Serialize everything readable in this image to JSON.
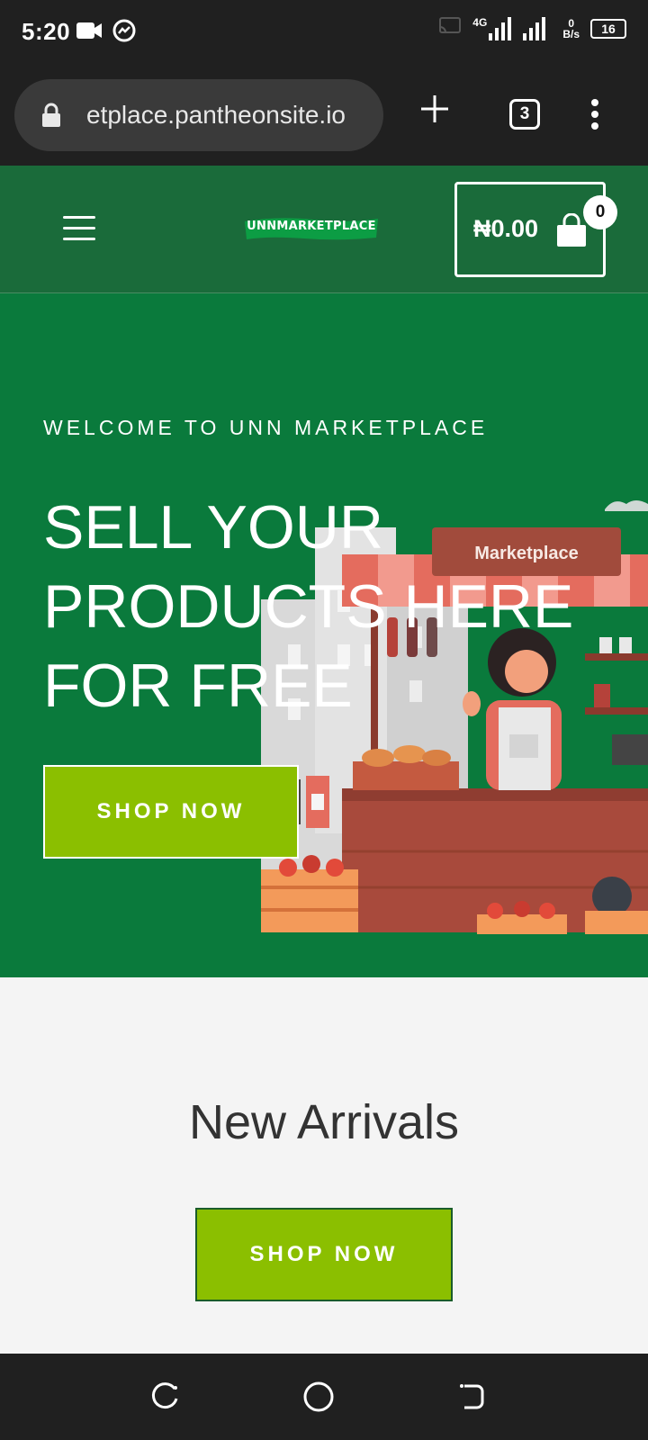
{
  "status_bar": {
    "time": "5:20",
    "network": "4G",
    "data_rate_value": "0",
    "data_rate_unit": "B/s",
    "battery": "16"
  },
  "browser": {
    "url": "etplace.pantheonsite.io",
    "tab_count": "3"
  },
  "header": {
    "logo_text": "UNNMARKETPLACE",
    "cart_total": "₦0.00",
    "cart_count": "0"
  },
  "hero": {
    "kicker": "WELCOME TO UNN MARKETPLACE",
    "title": "SELL YOUR PRODUCTS HERE FOR FREE",
    "button_label": "SHOP NOW",
    "stall_sign": "Marketplace"
  },
  "arrivals": {
    "title": "New Arrivals",
    "button_label": "SHOP NOW"
  },
  "colors": {
    "header_green": "#1a6b3a",
    "hero_green": "#0a7a3c",
    "button_lime": "#8bbf00",
    "system_bar": "#202020"
  },
  "icons": {
    "status_left": [
      "video-camera-icon",
      "messenger-icon"
    ],
    "status_right": [
      "cast-icon",
      "signal-icon",
      "battery-icon"
    ],
    "browser": [
      "lock-icon",
      "plus-icon",
      "more-vert-icon"
    ],
    "nav": [
      "recents-icon",
      "home-icon",
      "back-icon"
    ]
  }
}
